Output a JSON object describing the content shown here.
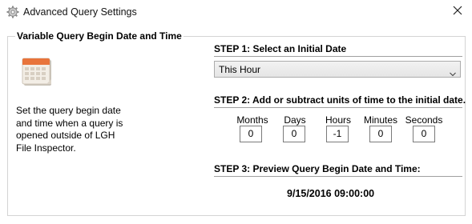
{
  "window": {
    "title": "Advanced Query Settings"
  },
  "group": {
    "legend": "Variable Query Begin Date and Time"
  },
  "description": {
    "line1": "Set the query begin date",
    "line2": "and time when a query is",
    "line3": "opened outside of LGH",
    "line4": "File Inspector."
  },
  "step1": {
    "heading": "STEP 1: Select an Initial Date",
    "selected": "This Hour"
  },
  "step2": {
    "heading": "STEP 2: Add or subtract units of time to the initial date.",
    "units": [
      {
        "label": "Months",
        "value": "0"
      },
      {
        "label": "Days",
        "value": "0"
      },
      {
        "label": "Hours",
        "value": "-1"
      },
      {
        "label": "Minutes",
        "value": "0"
      },
      {
        "label": "Seconds",
        "value": "0"
      }
    ]
  },
  "step3": {
    "heading": "STEP 3: Preview Query Begin Date and Time:",
    "preview": "9/15/2016 09:00:00"
  },
  "icons": {
    "title": "gear-icon",
    "close": "close-icon",
    "calendar": "calendar-icon",
    "dropdown": "chevron-down-icon"
  },
  "colors": {
    "calendar_header": "#e8743b",
    "calendar_body": "#f3eee6",
    "group_border": "#d4d4d4"
  }
}
